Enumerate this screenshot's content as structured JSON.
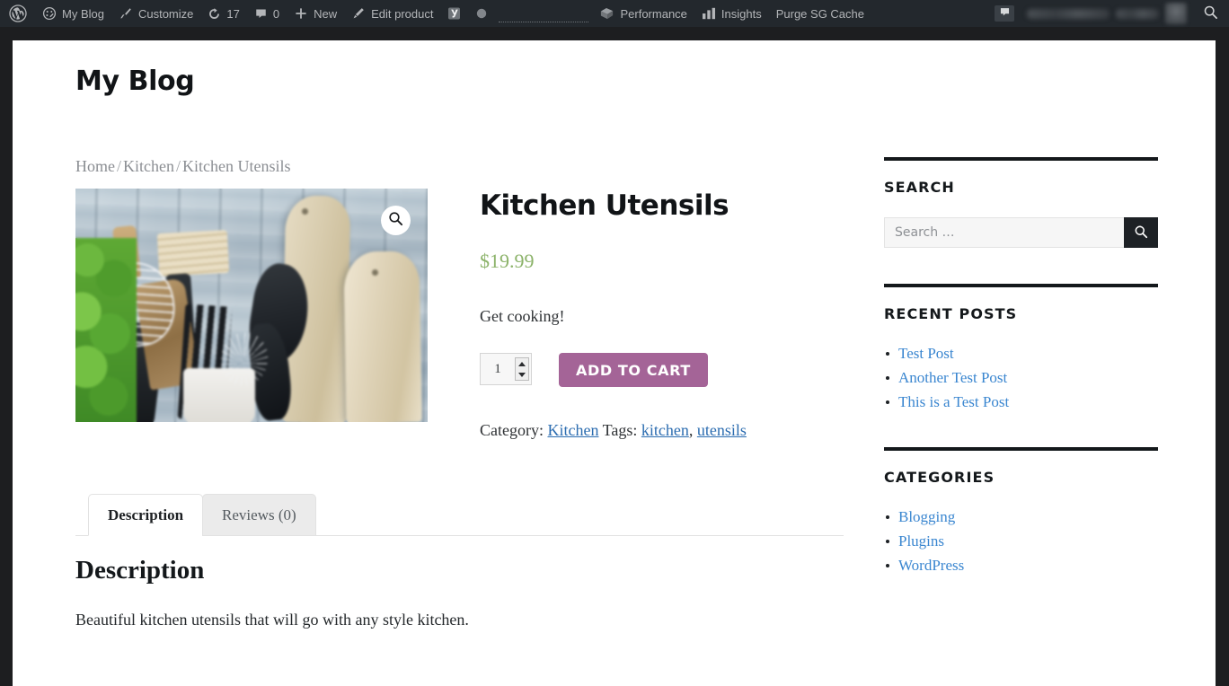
{
  "adminbar": {
    "wp_logo_label": "WordPress",
    "items": [
      {
        "name": "my-blog",
        "label": "My Blog",
        "icon": "dashboard-icon"
      },
      {
        "name": "customize",
        "label": "Customize",
        "icon": "paintbrush-icon"
      },
      {
        "name": "updates",
        "label": "17",
        "icon": "updates-icon"
      },
      {
        "name": "comments",
        "label": "0",
        "icon": "comment-bubble-icon"
      },
      {
        "name": "new",
        "label": "New",
        "icon": "plus-icon"
      },
      {
        "name": "edit-product",
        "label": "Edit product",
        "icon": "pencil-icon"
      }
    ],
    "yoast_icon": "yoast-seo-icon",
    "seo_dot_icon": "seo-status-dot-icon",
    "right_items": [
      {
        "name": "performance",
        "label": "Performance",
        "icon": "performance-icon"
      },
      {
        "name": "insights",
        "label": "Insights",
        "icon": "bar-chart-icon"
      },
      {
        "name": "purge-sg-cache",
        "label": "Purge SG Cache",
        "icon": ""
      }
    ],
    "comment_icon": "comment-bubble-icon",
    "search_icon": "search-icon"
  },
  "header": {
    "site_title": "My Blog"
  },
  "breadcrumb": {
    "items": [
      "Home",
      "Kitchen",
      "Kitchen Utensils"
    ],
    "separator": "/"
  },
  "product": {
    "title": "Kitchen Utensils",
    "price": "$19.99",
    "short_description": "Get cooking!",
    "quantity": "1",
    "add_to_cart_label": "Add to cart",
    "zoom_icon": "magnifier-icon",
    "image_alt": "Kitchen utensils in a white crock with wooden cutting boards and basil",
    "meta": {
      "category_label": "Category:",
      "category": "Kitchen",
      "tags_label": "Tags:",
      "tags": [
        "kitchen",
        "utensils"
      ]
    },
    "tabs": [
      {
        "name": "tab-description",
        "label": "Description",
        "active": true
      },
      {
        "name": "tab-reviews",
        "label": "Reviews (0)",
        "active": false
      }
    ],
    "description_heading": "Description",
    "description_text": "Beautiful kitchen utensils that will go with any style kitchen."
  },
  "sidebar": {
    "search": {
      "title": "Search",
      "placeholder": "Search …",
      "value": "",
      "button_icon": "search-icon"
    },
    "recent_posts": {
      "title": "Recent Posts",
      "items": [
        "Test Post",
        "Another Test Post",
        "This is a Test Post"
      ]
    },
    "categories": {
      "title": "Categories",
      "items": [
        "Blogging",
        "Plugins",
        "WordPress"
      ]
    }
  },
  "colors": {
    "admin_bar_bg": "#23282d",
    "page_bg": "#1d1e20",
    "accent_button": "#a46497",
    "price": "#8cb36a",
    "link": "#3a86d0",
    "meta_link": "#2b6cb0",
    "heading": "#14181b"
  }
}
